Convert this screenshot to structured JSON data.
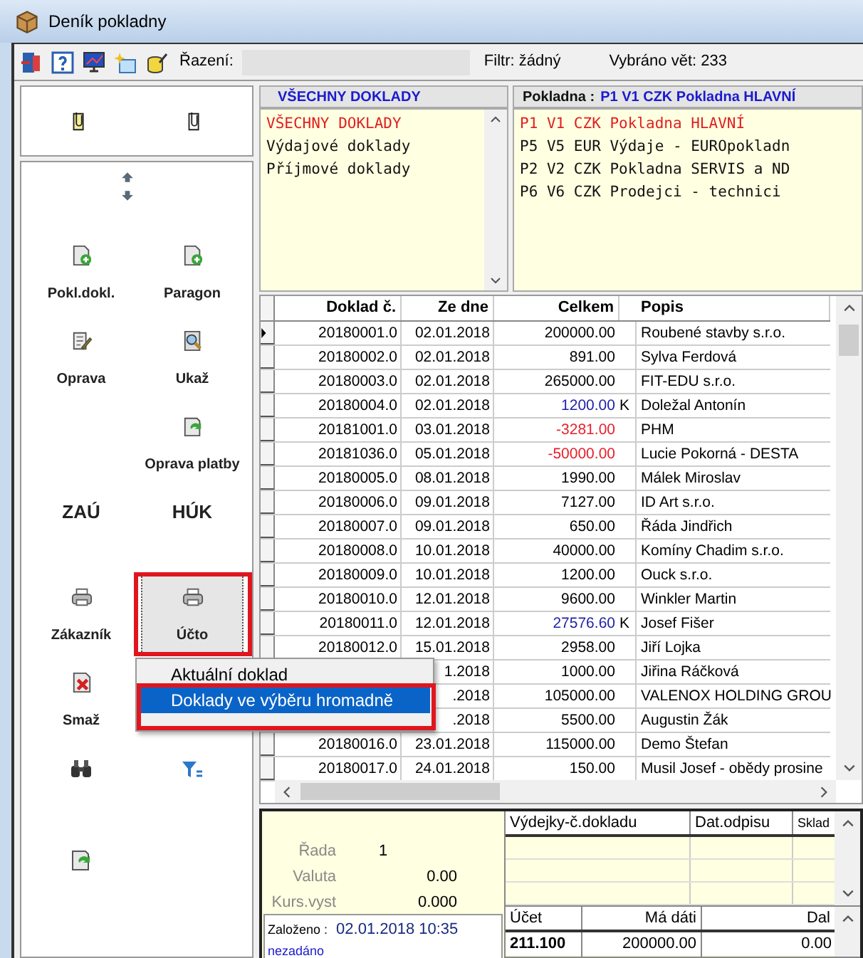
{
  "window": {
    "title": "Deník pokladny"
  },
  "toolbar": {
    "sort_label": "Řazení:",
    "filter": "Filtr: žádný",
    "selected_count": "Vybráno vět: 233"
  },
  "side_buttons": [
    {
      "kind": "icon",
      "label": "Pokl.dokl."
    },
    {
      "kind": "icon",
      "label": "Paragon"
    },
    {
      "kind": "icon",
      "label": "Oprava"
    },
    {
      "kind": "icon",
      "label": "Ukaž"
    },
    {
      "kind": "empty"
    },
    {
      "kind": "icon",
      "label": "Oprava platby"
    },
    {
      "kind": "text",
      "label": "ZAÚ"
    },
    {
      "kind": "text",
      "label": "HÚK"
    },
    {
      "kind": "icon",
      "label": "Zákazník"
    },
    {
      "kind": "icon",
      "label": "Účto",
      "pressed": true
    },
    {
      "kind": "icon",
      "label": "Smaž"
    },
    {
      "kind": "empty"
    },
    {
      "kind": "icon"
    },
    {
      "kind": "icon"
    },
    {
      "kind": "icon"
    }
  ],
  "doc_types": {
    "header": "VŠECHNY DOKLADY",
    "items": [
      {
        "label": "VŠECHNY DOKLADY",
        "selected": true
      },
      {
        "label": "Výdajové doklady",
        "selected": false
      },
      {
        "label": "Příjmové doklady",
        "selected": false
      }
    ]
  },
  "cash_desks": {
    "header_label": "Pokladna :",
    "header_value": "P1 V1 CZK Pokladna HLAVNÍ",
    "items": [
      {
        "label": "P1 V1 CZK Pokladna HLAVNÍ",
        "selected": true
      },
      {
        "label": "P5 V5 EUR Výdaje - EUROpokladn",
        "selected": false
      },
      {
        "label": "P2 V2 CZK Pokladna SERVIS a ND",
        "selected": false
      },
      {
        "label": "P6 V6 CZK Prodejci - technici",
        "selected": false
      }
    ]
  },
  "table": {
    "columns": [
      "Doklad č.",
      "Ze dne",
      "Celkem",
      "Popis"
    ],
    "rows": [
      {
        "doklad": "20180001.0",
        "date": "02.01.2018",
        "total": "200000.00",
        "flag": "",
        "desc": "Roubené stavby s.r.o.",
        "color": "#000000",
        "selected": true
      },
      {
        "doklad": "20180002.0",
        "date": "02.01.2018",
        "total": "891.00",
        "flag": "",
        "desc": "Sylva Ferdová",
        "color": "#000000",
        "selected": false
      },
      {
        "doklad": "20180003.0",
        "date": "02.01.2018",
        "total": "265000.00",
        "flag": "",
        "desc": "FIT-EDU s.r.o.",
        "color": "#000000",
        "selected": false
      },
      {
        "doklad": "20180004.0",
        "date": "02.01.2018",
        "total": "1200.00",
        "flag": "K",
        "desc": "Doležal Antonín",
        "color": "#1f1fa8",
        "selected": false
      },
      {
        "doklad": "20181001.0",
        "date": "03.01.2018",
        "total": "-3281.00",
        "flag": "",
        "desc": "PHM",
        "color": "#e8202a",
        "selected": false
      },
      {
        "doklad": "20181036.0",
        "date": "05.01.2018",
        "total": "-50000.00",
        "flag": "",
        "desc": "Lucie Pokorná - DESTA",
        "color": "#e8202a",
        "selected": false
      },
      {
        "doklad": "20180005.0",
        "date": "08.01.2018",
        "total": "1990.00",
        "flag": "",
        "desc": "Málek Miroslav",
        "color": "#000000",
        "selected": false
      },
      {
        "doklad": "20180006.0",
        "date": "09.01.2018",
        "total": "7127.00",
        "flag": "",
        "desc": "ID Art s.r.o.",
        "color": "#000000",
        "selected": false
      },
      {
        "doklad": "20180007.0",
        "date": "09.01.2018",
        "total": "650.00",
        "flag": "",
        "desc": "Řáda Jindřich",
        "color": "#000000",
        "selected": false
      },
      {
        "doklad": "20180008.0",
        "date": "10.01.2018",
        "total": "40000.00",
        "flag": "",
        "desc": "Komíny Chadim s.r.o.",
        "color": "#000000",
        "selected": false
      },
      {
        "doklad": "20180009.0",
        "date": "10.01.2018",
        "total": "1200.00",
        "flag": "",
        "desc": "Ouck s.r.o.",
        "color": "#000000",
        "selected": false
      },
      {
        "doklad": "20180010.0",
        "date": "12.01.2018",
        "total": "9600.00",
        "flag": "",
        "desc": "Winkler Martin",
        "color": "#000000",
        "selected": false
      },
      {
        "doklad": "20180011.0",
        "date": "12.01.2018",
        "total": "27576.60",
        "flag": "K",
        "desc": "Josef Fišer",
        "color": "#1f1fa8",
        "selected": false
      },
      {
        "doklad": "20180012.0",
        "date": "15.01.2018",
        "total": "2958.00",
        "flag": "",
        "desc": "Jiří Lojka",
        "color": "#000000",
        "selected": false
      },
      {
        "doklad": "",
        "date": "1.2018",
        "total": "1000.00",
        "flag": "",
        "desc": "Jiřina Ráčková",
        "color": "#000000"
      },
      {
        "doklad": "",
        "date": ".2018",
        "total": "105000.00",
        "flag": "",
        "desc": "VALENOX HOLDING GROU",
        "color": "#000000"
      },
      {
        "doklad": "",
        "date": ".2018",
        "total": "5500.00",
        "flag": "",
        "desc": "Augustin Žák",
        "color": "#000000"
      },
      {
        "doklad": "20180016.0",
        "date": "23.01.2018",
        "total": "115000.00",
        "flag": "",
        "desc": "Demo Štefan",
        "color": "#000000",
        "selected": false
      },
      {
        "doklad": "20180017.0",
        "date": "24.01.2018",
        "total": "150.00",
        "flag": "",
        "desc": "Musil Josef - obědy prosine",
        "color": "#000000",
        "selected": false
      }
    ]
  },
  "context_menu": {
    "items": [
      {
        "label": "Aktuální doklad",
        "selected": false
      },
      {
        "label": "Doklady ve výběru hromadně",
        "selected": true
      }
    ]
  },
  "detail": {
    "fields": [
      {
        "label": "Řada",
        "value": "1"
      },
      {
        "label": "Valuta",
        "value": "0.00"
      },
      {
        "label": "Kurs.vyst",
        "value": "0.000"
      }
    ],
    "created_label": "Založeno :",
    "created_value": "02.01.2018 10:35",
    "note": "nezadáno",
    "issues": {
      "columns": [
        "Výdejky-č.dokladu",
        "Dat.odpisu",
        "Sklad"
      ]
    },
    "postings": {
      "columns": [
        "Účet",
        "Má dáti",
        "Dal"
      ],
      "rows": [
        {
          "account": "211.100",
          "debit": "200000.00",
          "credit": "0.00"
        }
      ]
    }
  }
}
